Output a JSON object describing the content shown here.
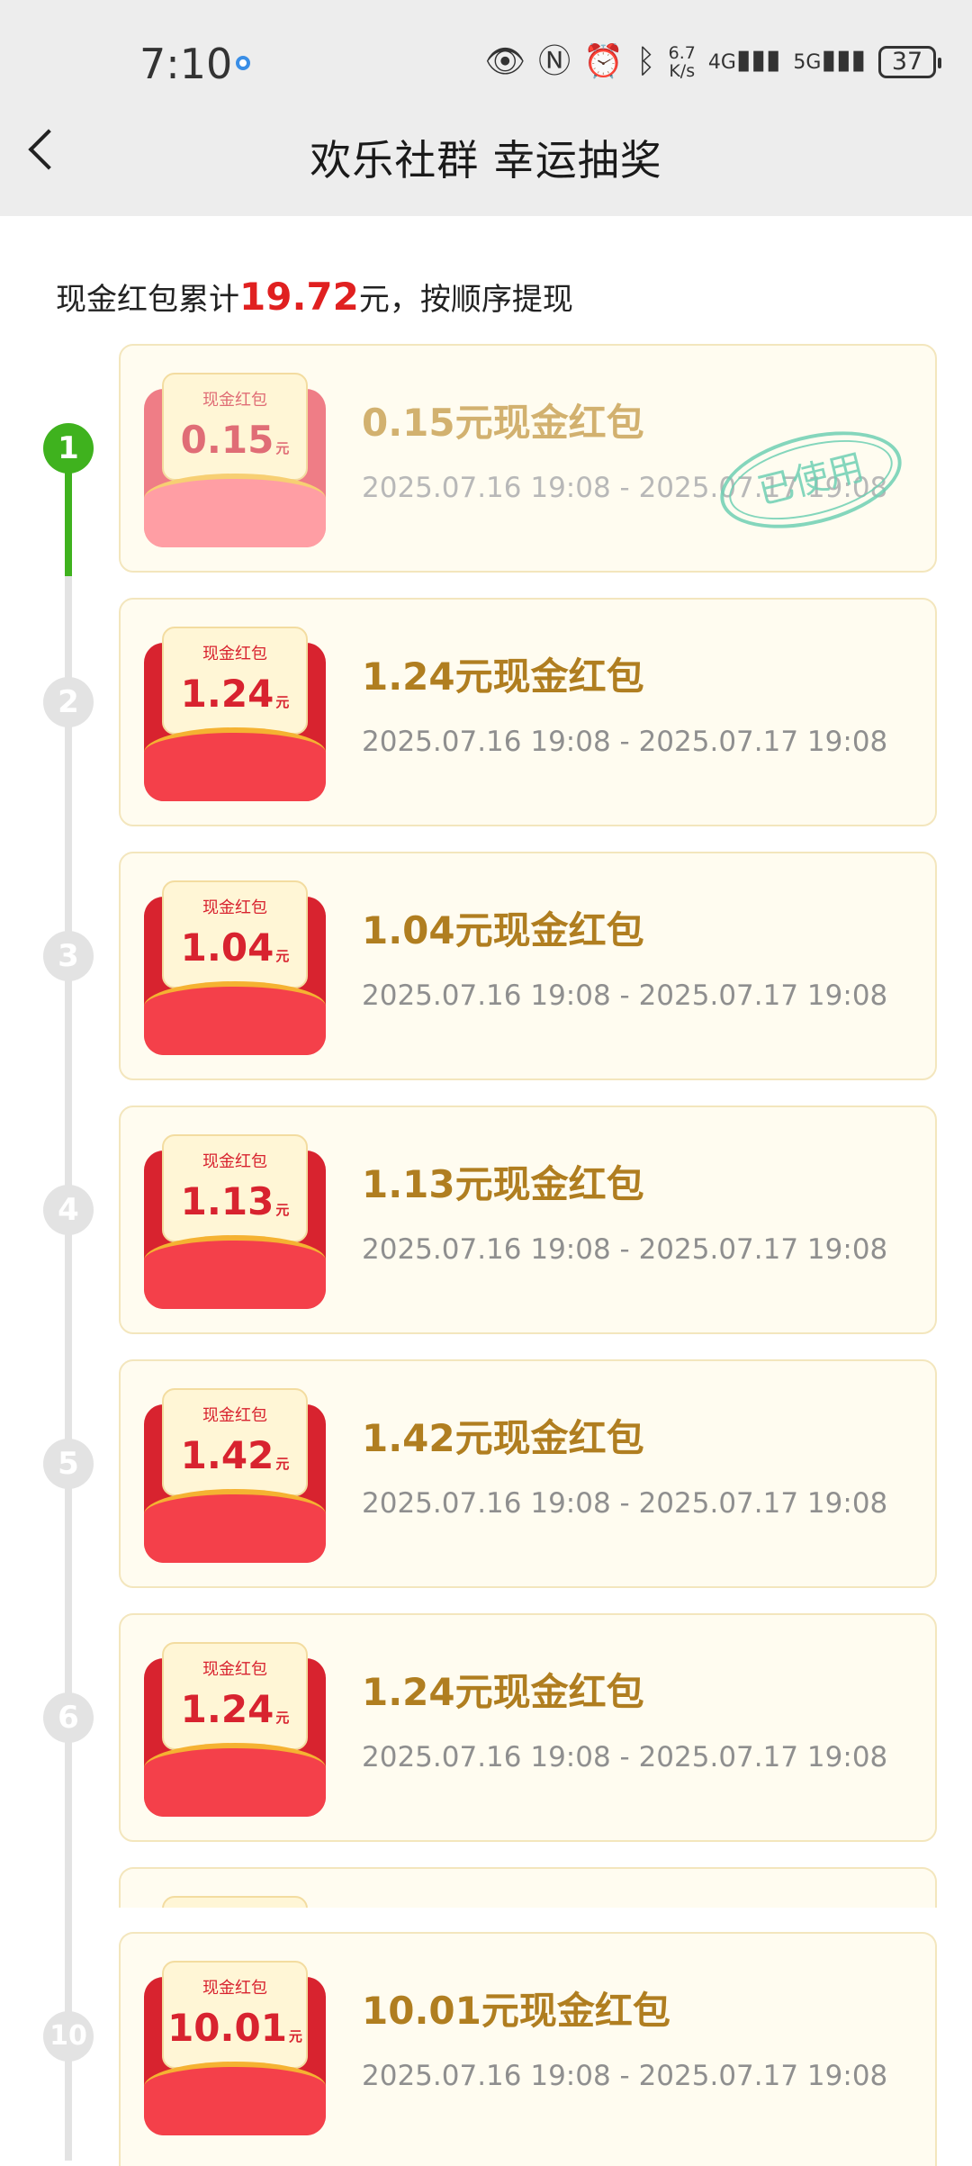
{
  "status_bar": {
    "time": "7:10",
    "net_speed_value": "6.7",
    "net_speed_unit": "K/s",
    "signal_1": "4G",
    "signal_2": "5G",
    "battery": "37"
  },
  "header": {
    "title": "欢乐社群 幸运抽奖"
  },
  "summary": {
    "prefix": "现金红包累计",
    "amount": "19.72",
    "suffix": "元，按顺序提现"
  },
  "envelope_label": "现金红包",
  "yuan_unit": "元",
  "used_stamp": "已使用",
  "items": [
    {
      "index": "1",
      "value": "0.15",
      "title": "0.15元现金红包",
      "time": "2025.07.16 19:08 - 2025.07.17 19:08",
      "status": "used"
    },
    {
      "index": "2",
      "value": "1.24",
      "title": "1.24元现金红包",
      "time": "2025.07.16 19:08 - 2025.07.17 19:08",
      "status": "pending"
    },
    {
      "index": "3",
      "value": "1.04",
      "title": "1.04元现金红包",
      "time": "2025.07.16 19:08 - 2025.07.17 19:08",
      "status": "pending"
    },
    {
      "index": "4",
      "value": "1.13",
      "title": "1.13元现金红包",
      "time": "2025.07.16 19:08 - 2025.07.17 19:08",
      "status": "pending"
    },
    {
      "index": "5",
      "value": "1.42",
      "title": "1.42元现金红包",
      "time": "2025.07.16 19:08 - 2025.07.17 19:08",
      "status": "pending"
    },
    {
      "index": "6",
      "value": "1.24",
      "title": "1.24元现金红包",
      "time": "2025.07.16 19:08 - 2025.07.17 19:08",
      "status": "pending"
    },
    {
      "index": "10",
      "value": "10.01",
      "title": "10.01元现金红包",
      "time": "2025.07.16 19:08 - 2025.07.17 19:08",
      "status": "pending"
    }
  ],
  "colors": {
    "accent_green": "#3fb21e",
    "amount_red": "#e02020",
    "title_gold": "#b07e20"
  }
}
